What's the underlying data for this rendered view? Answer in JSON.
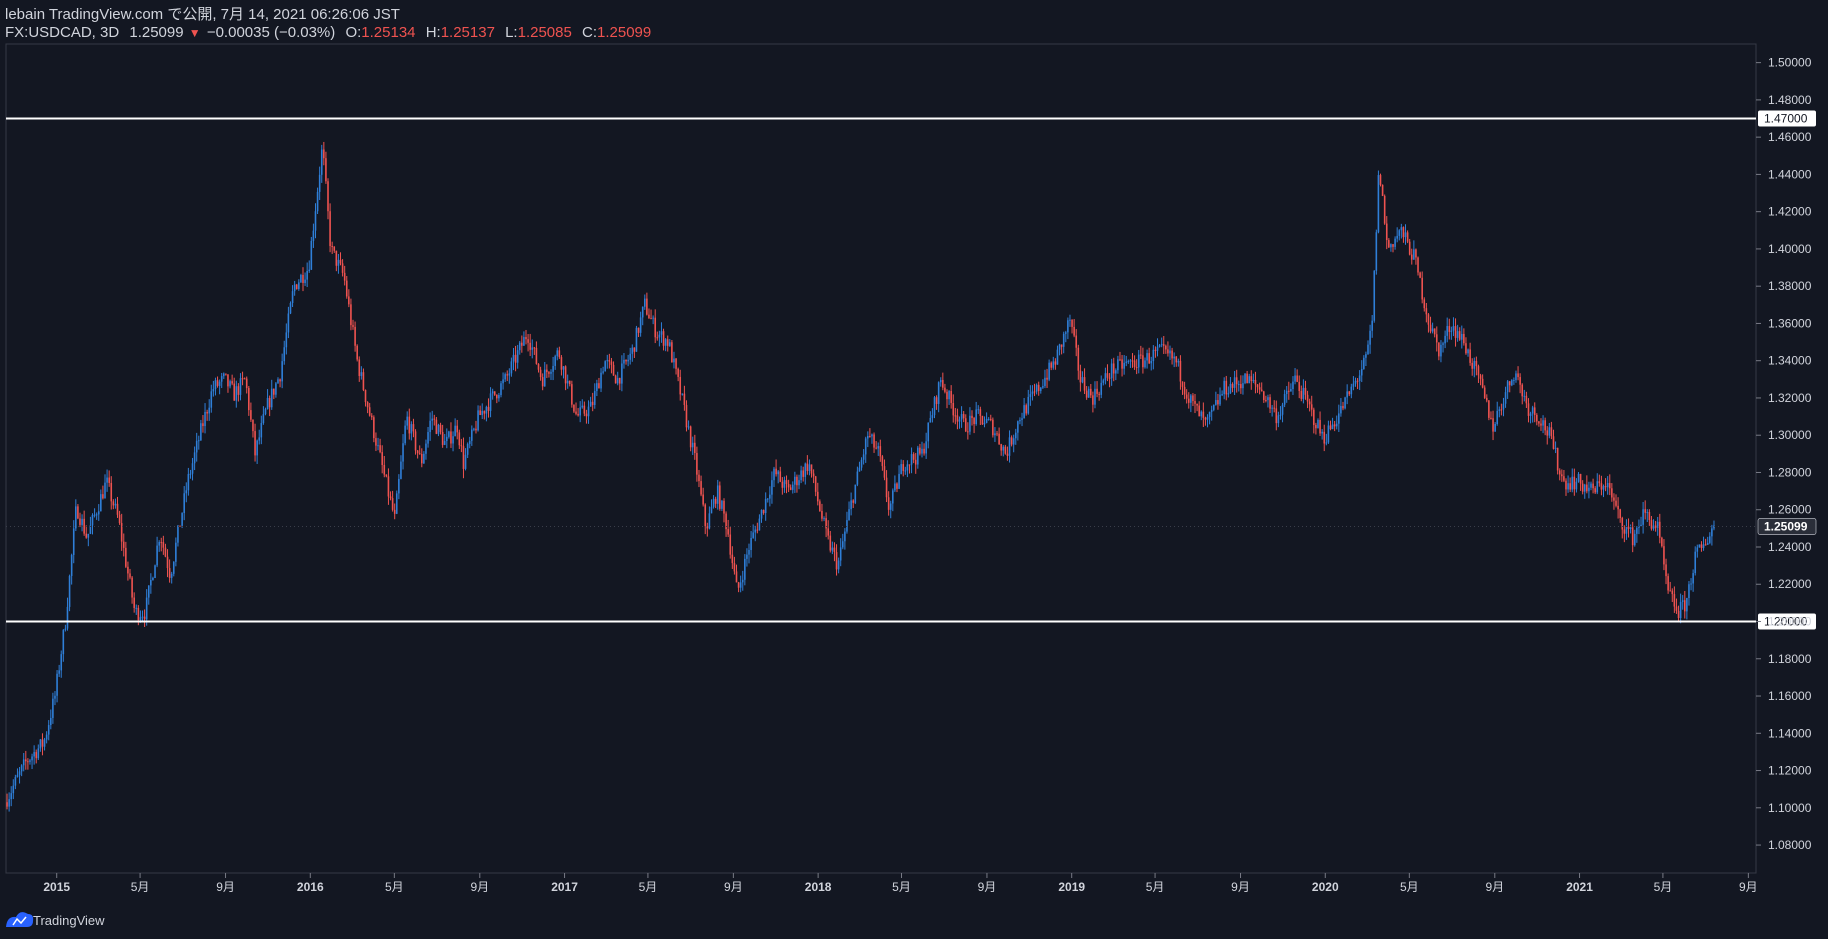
{
  "header": {
    "line1": "lebain TradingView.com で公開, 7月 14, 2021 06:26:06 JST",
    "symbol": "FX:USDCAD, 3D",
    "last": "1.25099",
    "change_arrow": "▼",
    "change": "−0.00035 (−0.03%)",
    "o_label": "O:",
    "o_value": "1.25134",
    "h_label": "H:",
    "h_value": "1.25137",
    "l_label": "L:",
    "l_value": "1.25085",
    "c_label": "C:",
    "c_value": "1.25099"
  },
  "footer": {
    "brand": "TradingView",
    "logo_icon": "tradingview-cloud-icon"
  },
  "colors": {
    "background": "#131722",
    "up": "#2f7fd8",
    "down": "#ef5350",
    "text": "#d1d4dc",
    "frame": "#363a45",
    "hline": "#ffffff"
  },
  "chart_data": {
    "type": "candlestick",
    "symbol": "FX:USDCAD",
    "interval": "3D",
    "x_range": [
      "2014-10-20",
      "2021-09-12"
    ],
    "ylim": [
      1.065,
      1.51
    ],
    "y_ticks": [
      1.08,
      1.1,
      1.12,
      1.14,
      1.16,
      1.18,
      1.2,
      1.22,
      1.24,
      1.26,
      1.28,
      1.3,
      1.32,
      1.34,
      1.36,
      1.38,
      1.4,
      1.42,
      1.44,
      1.46,
      1.48,
      1.5
    ],
    "y_tick_labels": [
      "1.08000",
      "1.10000",
      "1.12000",
      "1.14000",
      "1.16000",
      "1.18000",
      "1.20000",
      "1.22000",
      "1.24000",
      "1.26000",
      "1.28000",
      "1.30000",
      "1.32000",
      "1.34000",
      "1.36000",
      "1.38000",
      "1.40000",
      "1.42000",
      "1.44000",
      "1.46000",
      "1.48000",
      "1.50000"
    ],
    "x_ticks": [
      {
        "date": "2015-01-01",
        "label": "2015",
        "bold": true
      },
      {
        "date": "2015-05-01",
        "label": "5月"
      },
      {
        "date": "2015-09-01",
        "label": "9月"
      },
      {
        "date": "2016-01-01",
        "label": "2016",
        "bold": true
      },
      {
        "date": "2016-05-01",
        "label": "5月"
      },
      {
        "date": "2016-09-01",
        "label": "9月"
      },
      {
        "date": "2017-01-01",
        "label": "2017",
        "bold": true
      },
      {
        "date": "2017-05-01",
        "label": "5月"
      },
      {
        "date": "2017-09-01",
        "label": "9月"
      },
      {
        "date": "2018-01-01",
        "label": "2018",
        "bold": true
      },
      {
        "date": "2018-05-01",
        "label": "5月"
      },
      {
        "date": "2018-09-01",
        "label": "9月"
      },
      {
        "date": "2019-01-01",
        "label": "2019",
        "bold": true
      },
      {
        "date": "2019-05-01",
        "label": "5月"
      },
      {
        "date": "2019-09-01",
        "label": "9月"
      },
      {
        "date": "2020-01-01",
        "label": "2020",
        "bold": true
      },
      {
        "date": "2020-05-01",
        "label": "5月"
      },
      {
        "date": "2020-09-01",
        "label": "9月"
      },
      {
        "date": "2021-01-01",
        "label": "2021",
        "bold": true
      },
      {
        "date": "2021-05-01",
        "label": "5月"
      },
      {
        "date": "2021-09-01",
        "label": "9月"
      }
    ],
    "horizontal_lines": [
      {
        "value": 1.47,
        "label": "1.47000"
      },
      {
        "value": 1.2,
        "label": "1.20000"
      }
    ],
    "last_price": {
      "value": 1.25099,
      "label": "1.25099"
    },
    "price_path": [
      {
        "date": "2014-10-20",
        "close": 1.103
      },
      {
        "date": "2014-11-20",
        "close": 1.125
      },
      {
        "date": "2014-12-15",
        "close": 1.135
      },
      {
        "date": "2014-12-31",
        "close": 1.16
      },
      {
        "date": "2015-01-15",
        "close": 1.2
      },
      {
        "date": "2015-01-31",
        "close": 1.262
      },
      {
        "date": "2015-02-15",
        "close": 1.245
      },
      {
        "date": "2015-03-15",
        "close": 1.275
      },
      {
        "date": "2015-04-01",
        "close": 1.255
      },
      {
        "date": "2015-04-25",
        "close": 1.205
      },
      {
        "date": "2015-05-10",
        "close": 1.205
      },
      {
        "date": "2015-05-31",
        "close": 1.248
      },
      {
        "date": "2015-06-15",
        "close": 1.225
      },
      {
        "date": "2015-07-10",
        "close": 1.275
      },
      {
        "date": "2015-07-31",
        "close": 1.305
      },
      {
        "date": "2015-08-15",
        "close": 1.325
      },
      {
        "date": "2015-09-01",
        "close": 1.33
      },
      {
        "date": "2015-09-15",
        "close": 1.322
      },
      {
        "date": "2015-10-01",
        "close": 1.33
      },
      {
        "date": "2015-10-15",
        "close": 1.29
      },
      {
        "date": "2015-11-01",
        "close": 1.315
      },
      {
        "date": "2015-11-20",
        "close": 1.333
      },
      {
        "date": "2015-12-10",
        "close": 1.38
      },
      {
        "date": "2015-12-31",
        "close": 1.39
      },
      {
        "date": "2016-01-20",
        "close": 1.455
      },
      {
        "date": "2016-02-01",
        "close": 1.4
      },
      {
        "date": "2016-02-20",
        "close": 1.385
      },
      {
        "date": "2016-03-10",
        "close": 1.34
      },
      {
        "date": "2016-04-01",
        "close": 1.305
      },
      {
        "date": "2016-04-20",
        "close": 1.275
      },
      {
        "date": "2016-05-03",
        "close": 1.255
      },
      {
        "date": "2016-05-20",
        "close": 1.31
      },
      {
        "date": "2016-06-10",
        "close": 1.285
      },
      {
        "date": "2016-06-25",
        "close": 1.31
      },
      {
        "date": "2016-07-15",
        "close": 1.295
      },
      {
        "date": "2016-08-01",
        "close": 1.305
      },
      {
        "date": "2016-08-10",
        "close": 1.285
      },
      {
        "date": "2016-09-01",
        "close": 1.31
      },
      {
        "date": "2016-09-20",
        "close": 1.32
      },
      {
        "date": "2016-10-10",
        "close": 1.33
      },
      {
        "date": "2016-11-10",
        "close": 1.355
      },
      {
        "date": "2016-12-01",
        "close": 1.33
      },
      {
        "date": "2016-12-25",
        "close": 1.345
      },
      {
        "date": "2017-01-20",
        "close": 1.31
      },
      {
        "date": "2017-02-10",
        "close": 1.315
      },
      {
        "date": "2017-03-01",
        "close": 1.34
      },
      {
        "date": "2017-03-20",
        "close": 1.33
      },
      {
        "date": "2017-04-10",
        "close": 1.345
      },
      {
        "date": "2017-04-28",
        "close": 1.37
      },
      {
        "date": "2017-05-15",
        "close": 1.355
      },
      {
        "date": "2017-06-01",
        "close": 1.35
      },
      {
        "date": "2017-06-20",
        "close": 1.32
      },
      {
        "date": "2017-07-10",
        "close": 1.285
      },
      {
        "date": "2017-07-25",
        "close": 1.25
      },
      {
        "date": "2017-08-10",
        "close": 1.27
      },
      {
        "date": "2017-08-25",
        "close": 1.25
      },
      {
        "date": "2017-09-08",
        "close": 1.215
      },
      {
        "date": "2017-09-25",
        "close": 1.24
      },
      {
        "date": "2017-10-10",
        "close": 1.255
      },
      {
        "date": "2017-11-01",
        "close": 1.28
      },
      {
        "date": "2017-11-20",
        "close": 1.27
      },
      {
        "date": "2017-12-20",
        "close": 1.285
      },
      {
        "date": "2018-01-15",
        "close": 1.245
      },
      {
        "date": "2018-01-31",
        "close": 1.23
      },
      {
        "date": "2018-02-20",
        "close": 1.265
      },
      {
        "date": "2018-03-15",
        "close": 1.3
      },
      {
        "date": "2018-03-31",
        "close": 1.29
      },
      {
        "date": "2018-04-15",
        "close": 1.26
      },
      {
        "date": "2018-05-05",
        "close": 1.285
      },
      {
        "date": "2018-06-01",
        "close": 1.29
      },
      {
        "date": "2018-06-28",
        "close": 1.33
      },
      {
        "date": "2018-07-15",
        "close": 1.315
      },
      {
        "date": "2018-08-01",
        "close": 1.305
      },
      {
        "date": "2018-08-20",
        "close": 1.31
      },
      {
        "date": "2018-09-10",
        "close": 1.305
      },
      {
        "date": "2018-09-30",
        "close": 1.29
      },
      {
        "date": "2018-10-20",
        "close": 1.31
      },
      {
        "date": "2018-11-15",
        "close": 1.325
      },
      {
        "date": "2018-12-10",
        "close": 1.34
      },
      {
        "date": "2018-12-31",
        "close": 1.362
      },
      {
        "date": "2019-01-15",
        "close": 1.33
      },
      {
        "date": "2019-02-01",
        "close": 1.32
      },
      {
        "date": "2019-03-01",
        "close": 1.335
      },
      {
        "date": "2019-03-20",
        "close": 1.338
      },
      {
        "date": "2019-04-15",
        "close": 1.34
      },
      {
        "date": "2019-05-10",
        "close": 1.345
      },
      {
        "date": "2019-06-01",
        "close": 1.34
      },
      {
        "date": "2019-06-20",
        "close": 1.32
      },
      {
        "date": "2019-07-15",
        "close": 1.305
      },
      {
        "date": "2019-08-10",
        "close": 1.325
      },
      {
        "date": "2019-09-10",
        "close": 1.33
      },
      {
        "date": "2019-10-01",
        "close": 1.325
      },
      {
        "date": "2019-10-25",
        "close": 1.31
      },
      {
        "date": "2019-11-20",
        "close": 1.33
      },
      {
        "date": "2019-12-10",
        "close": 1.315
      },
      {
        "date": "2019-12-31",
        "close": 1.298
      },
      {
        "date": "2020-01-20",
        "close": 1.31
      },
      {
        "date": "2020-02-10",
        "close": 1.325
      },
      {
        "date": "2020-03-01",
        "close": 1.34
      },
      {
        "date": "2020-03-10",
        "close": 1.36
      },
      {
        "date": "2020-03-20",
        "close": 1.445
      },
      {
        "date": "2020-04-01",
        "close": 1.4
      },
      {
        "date": "2020-04-20",
        "close": 1.41
      },
      {
        "date": "2020-05-10",
        "close": 1.395
      },
      {
        "date": "2020-05-31",
        "close": 1.36
      },
      {
        "date": "2020-06-15",
        "close": 1.345
      },
      {
        "date": "2020-07-01",
        "close": 1.36
      },
      {
        "date": "2020-07-20",
        "close": 1.35
      },
      {
        "date": "2020-08-10",
        "close": 1.33
      },
      {
        "date": "2020-08-31",
        "close": 1.305
      },
      {
        "date": "2020-09-15",
        "close": 1.32
      },
      {
        "date": "2020-10-01",
        "close": 1.335
      },
      {
        "date": "2020-10-20",
        "close": 1.315
      },
      {
        "date": "2020-11-05",
        "close": 1.31
      },
      {
        "date": "2020-11-20",
        "close": 1.3
      },
      {
        "date": "2020-12-10",
        "close": 1.275
      },
      {
        "date": "2020-12-31",
        "close": 1.275
      },
      {
        "date": "2021-01-20",
        "close": 1.27
      },
      {
        "date": "2021-02-10",
        "close": 1.275
      },
      {
        "date": "2021-03-01",
        "close": 1.255
      },
      {
        "date": "2021-03-20",
        "close": 1.245
      },
      {
        "date": "2021-04-05",
        "close": 1.258
      },
      {
        "date": "2021-04-25",
        "close": 1.25
      },
      {
        "date": "2021-05-10",
        "close": 1.215
      },
      {
        "date": "2021-05-25",
        "close": 1.205
      },
      {
        "date": "2021-06-05",
        "close": 1.21
      },
      {
        "date": "2021-06-18",
        "close": 1.235
      },
      {
        "date": "2021-06-30",
        "close": 1.24
      },
      {
        "date": "2021-07-13",
        "close": 1.251
      }
    ]
  }
}
